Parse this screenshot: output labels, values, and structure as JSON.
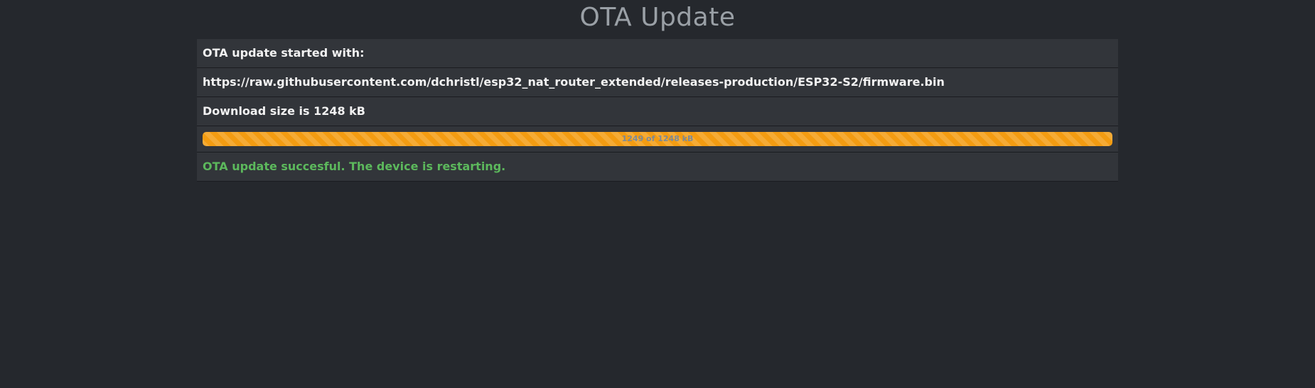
{
  "page": {
    "title": "OTA Update"
  },
  "ota": {
    "started_label": "OTA update started with:",
    "url": "https://raw.githubusercontent.com/dchristl/esp32_nat_router_extended/releases-production/ESP32-S2/firmware.bin",
    "download_size_text": "Download size is 1248 kB",
    "progress": {
      "text": "1249 of 1248 kB",
      "fraction": 1.0
    },
    "status_message": "OTA update succesful. The device is restarting."
  },
  "colors": {
    "background": "#25282d",
    "row_background": "#32353a",
    "progress_fill": "#f39c12",
    "success": "#5cb85c"
  }
}
